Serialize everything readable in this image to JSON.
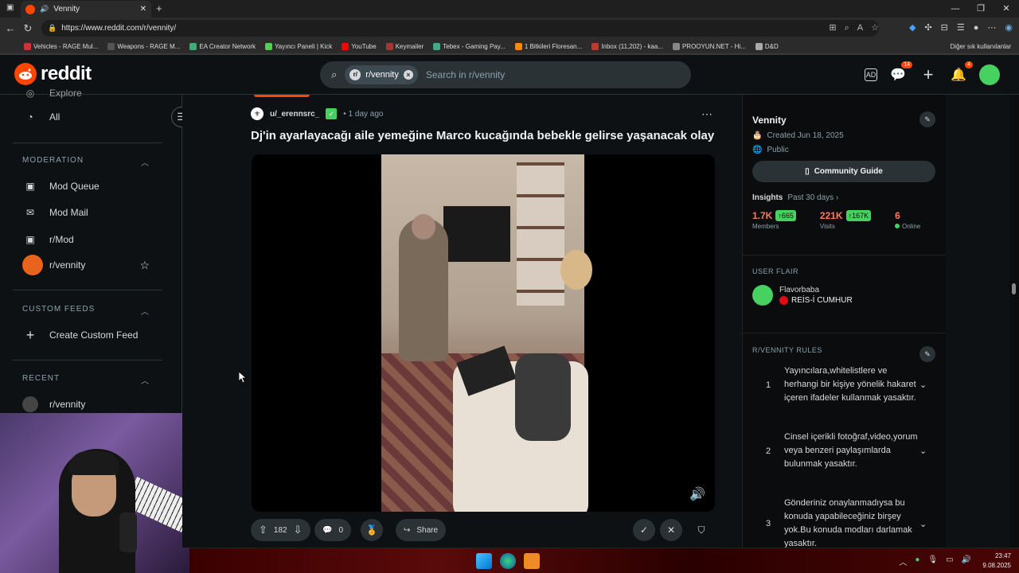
{
  "browser": {
    "tab_title": "Vennity",
    "url": "https://www.reddit.com/r/vennity/",
    "bookmarks": [
      "Vehicles - RAGE Mul...",
      "Weapons - RAGE M...",
      "EA Creator Network",
      "Yayıncı Paneli | Kick",
      "YouTube",
      "Keymailer",
      "Tebex - Gaming Pay...",
      "1 Bitkileri Floresan...",
      "Inbox (11,202) - kaa...",
      "PROOYUN.NET - Hi...",
      "D&D"
    ],
    "bookmarks_other": "Diğer sık kullanılanlar"
  },
  "header": {
    "logo": "reddit",
    "search_chip": "r/vennity",
    "search_placeholder": "Search in r/vennity",
    "chat_badge": "14",
    "notif_badge": "4"
  },
  "sidebar": {
    "explore": "Explore",
    "all": "All",
    "moderation_head": "MODERATION",
    "mod_items": [
      "Mod Queue",
      "Mod Mail",
      "r/Mod",
      "r/vennity"
    ],
    "custom_feeds_head": "CUSTOM FEEDS",
    "create_feed": "Create Custom Feed",
    "recent_head": "RECENT",
    "recent_item": "r/vennity"
  },
  "post": {
    "author": "u/_erennsrc_",
    "time": "• 1 day ago",
    "title": "Dj'in ayarlayacağı aile yemeğine Marco kucağında bebekle gelirse yaşanacak olay",
    "upvotes": "182",
    "comments": "0",
    "share": "Share"
  },
  "community": {
    "name": "Vennity",
    "created": "Created Jun 18, 2025",
    "visibility": "Public",
    "guide_btn": "Community Guide",
    "insights": "Insights",
    "insights_period": "Past 30 days ›",
    "members": "1.7K",
    "members_up": "↑665",
    "members_label": "Members",
    "visits": "221K",
    "visits_up": "↑167K",
    "visits_label": "Visits",
    "online": "6",
    "online_label": "Online",
    "user_flair_head": "USER FLAIR",
    "flair_user": "Flavorbaba",
    "flair_text": "REİS-İ CUMHUR",
    "rules_head": "R/VENNITY RULES",
    "rules": [
      {
        "n": "1",
        "t": "Yayıncılara,whitelistlere ve herhangi bir kişiye yönelik hakaret içeren ifadeler kullanmak yasaktır."
      },
      {
        "n": "2",
        "t": "Cinsel içerikli fotoğraf,video,yorum veya benzeri paylaşımlarda bulunmak yasaktır."
      },
      {
        "n": "3",
        "t": "Gönderiniz onaylanmadıysa bu konuda yapabileceğiniz birşey yok.Bu konuda modları darlamak yasaktır."
      }
    ]
  },
  "taskbar": {
    "time": "23:47",
    "date": "9.08.2025"
  },
  "colors": {
    "accent": "#ff4500",
    "green": "#46d160",
    "bg": "#0e1113"
  }
}
